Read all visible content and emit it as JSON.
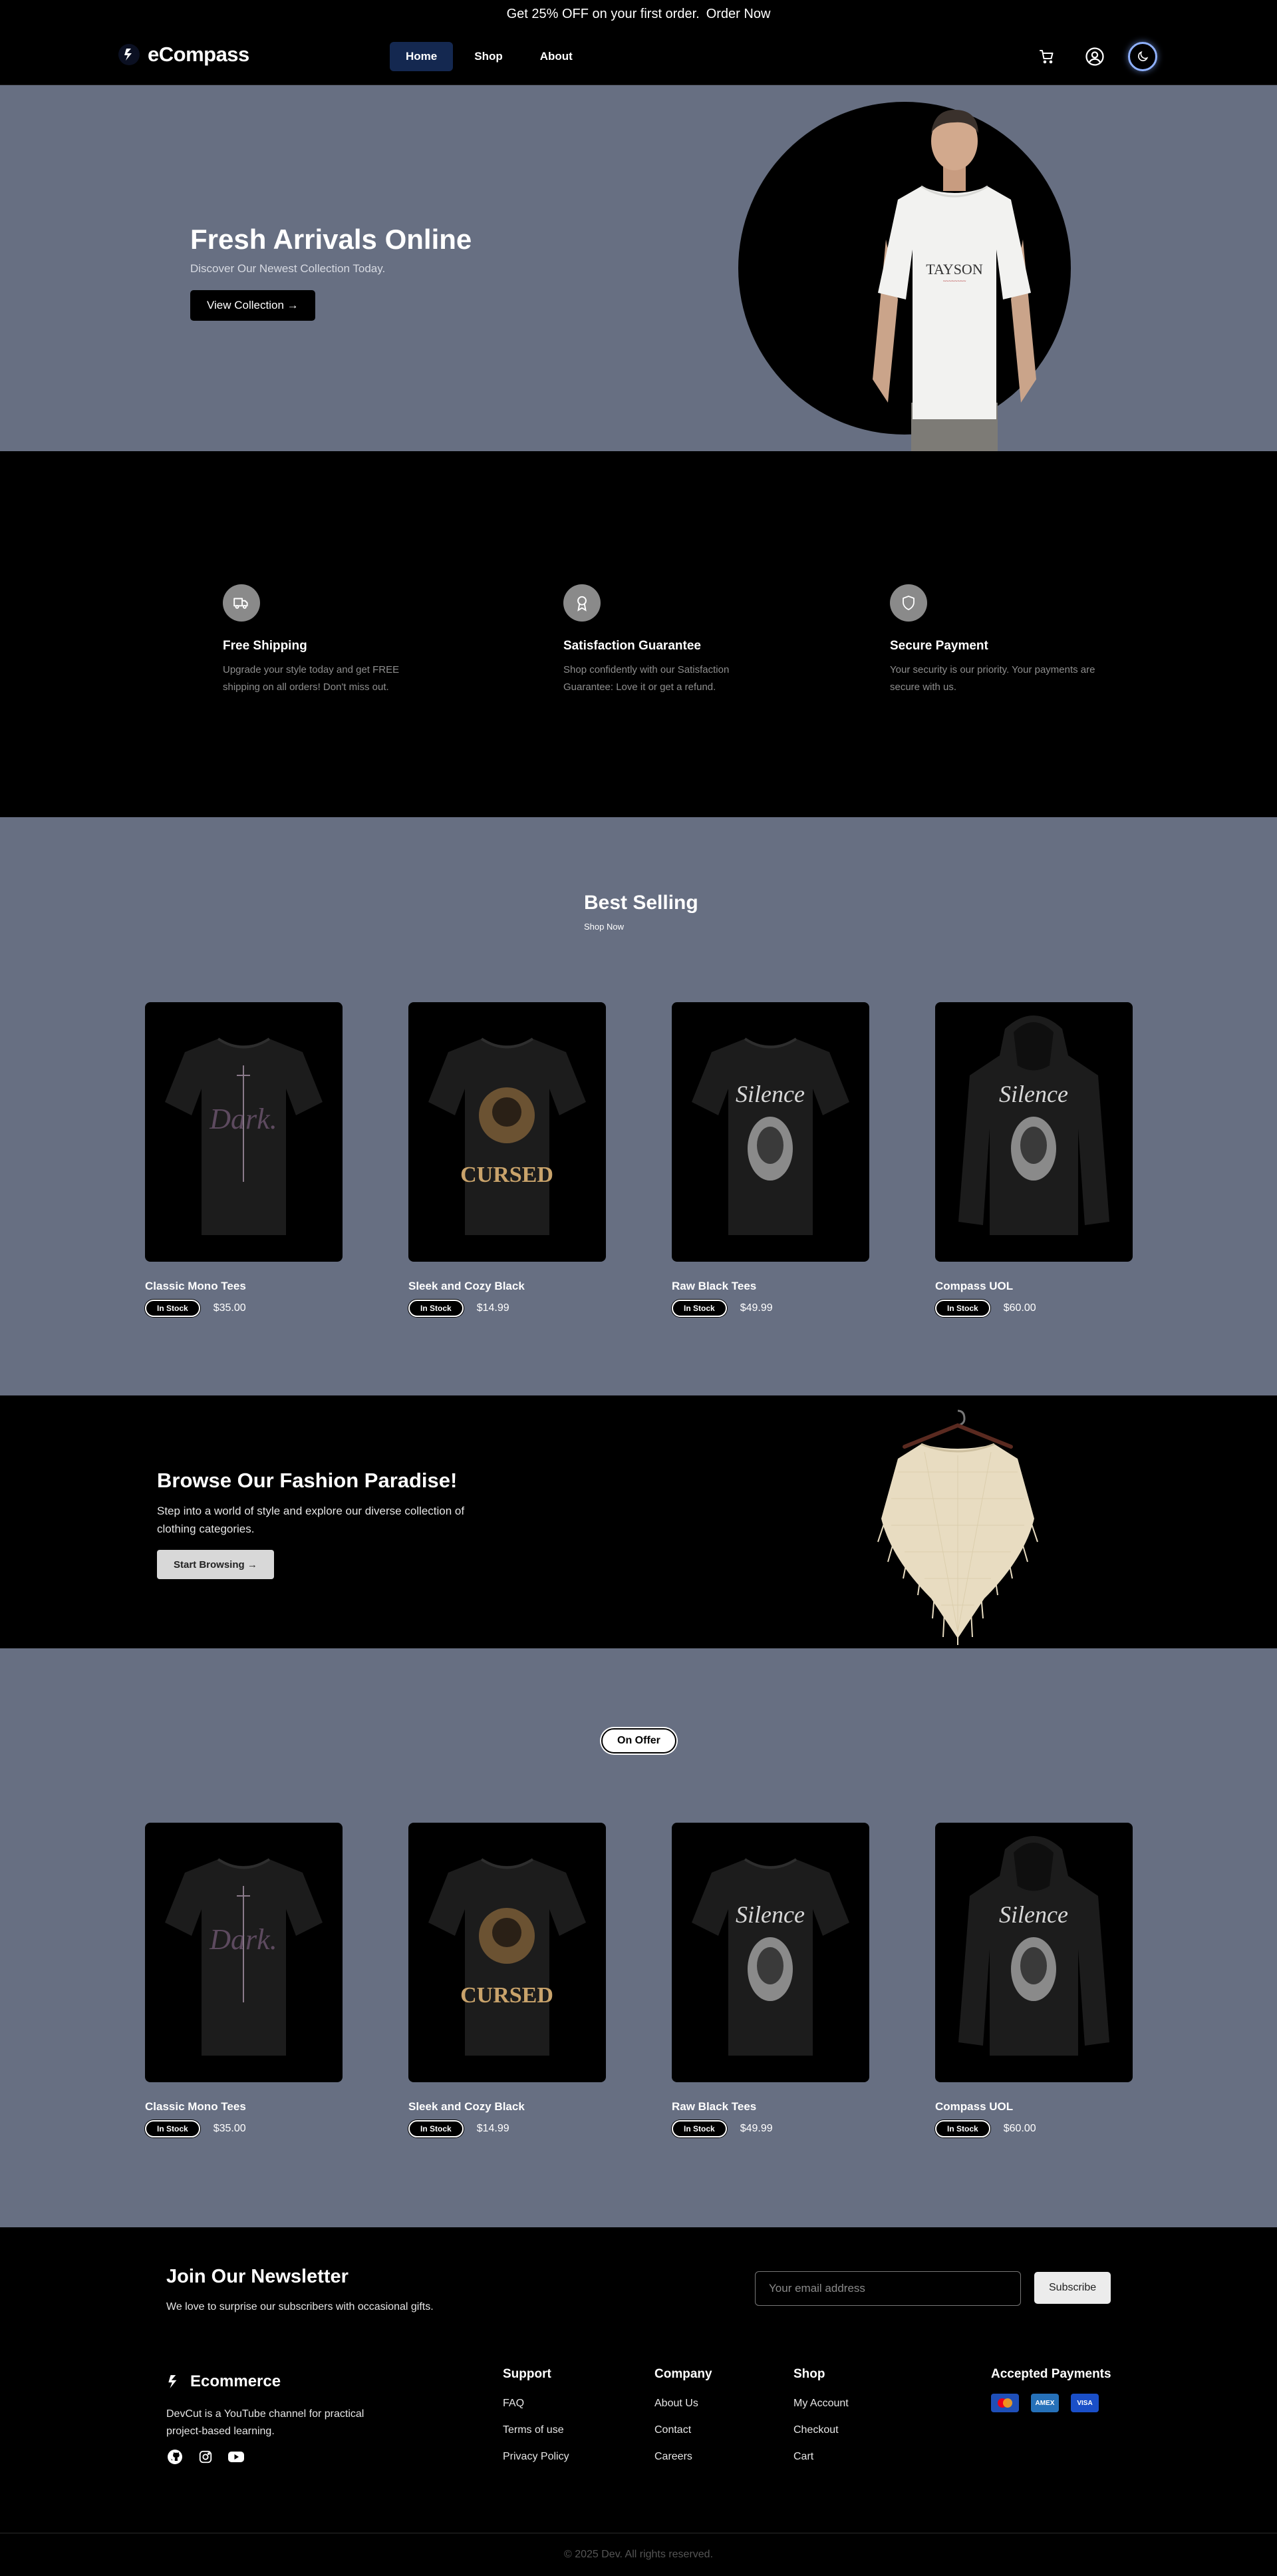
{
  "announcement": {
    "text": "Get 25% OFF on your first order.",
    "link": "Order Now"
  },
  "header": {
    "brand": "eCompass",
    "nav": [
      "Home",
      "Shop",
      "About"
    ]
  },
  "hero": {
    "title": "Fresh Arrivals Online",
    "subtitle": "Discover Our Newest Collection Today.",
    "button": "View Collection →",
    "shirt_text": "TAYSON"
  },
  "features": [
    {
      "title": "Free Shipping",
      "desc": "Upgrade your style today and get FREE shipping on all orders! Don't miss out.",
      "icon": "truck-icon"
    },
    {
      "title": "Satisfaction Guarantee",
      "desc": "Shop confidently with our Satisfaction Guarantee: Love it or get a refund.",
      "icon": "award-icon"
    },
    {
      "title": "Secure Payment",
      "desc": "Your security is our priority. Your payments are secure with us.",
      "icon": "shield-icon"
    }
  ],
  "best_selling": {
    "title": "Best Selling",
    "subtitle": "Shop Now",
    "products": [
      {
        "name": "Classic Mono Tees",
        "stock": "In Stock",
        "price": "$35.00",
        "art": "Dark."
      },
      {
        "name": "Sleek and Cozy Black",
        "stock": "In Stock",
        "price": "$14.99",
        "art": "CURSED"
      },
      {
        "name": "Raw Black Tees",
        "stock": "In Stock",
        "price": "$49.99",
        "art": "Silence"
      },
      {
        "name": "Compass UOL",
        "stock": "In Stock",
        "price": "$60.00",
        "art": "Silence"
      }
    ]
  },
  "banner": {
    "title": "Browse Our Fashion Paradise!",
    "desc": "Step into a world of style and explore our diverse collection of clothing categories.",
    "button": "Start Browsing →"
  },
  "on_offer": {
    "label": "On Offer",
    "products": [
      {
        "name": "Classic Mono Tees",
        "stock": "In Stock",
        "price": "$35.00",
        "art": "Dark."
      },
      {
        "name": "Sleek and Cozy Black",
        "stock": "In Stock",
        "price": "$14.99",
        "art": "CURSED"
      },
      {
        "name": "Raw Black Tees",
        "stock": "In Stock",
        "price": "$49.99",
        "art": "Silence"
      },
      {
        "name": "Compass UOL",
        "stock": "In Stock",
        "price": "$60.00",
        "art": "Silence"
      }
    ]
  },
  "newsletter": {
    "title": "Join Our Newsletter",
    "desc": "We love to surprise our subscribers with occasional gifts.",
    "placeholder": "Your email address",
    "button": "Subscribe"
  },
  "footer": {
    "brand": "Ecommerce",
    "desc": "DevCut is a YouTube channel for practical project-based learning.",
    "columns": [
      {
        "title": "Support",
        "links": [
          "FAQ",
          "Terms of use",
          "Privacy Policy"
        ]
      },
      {
        "title": "Company",
        "links": [
          "About Us",
          "Contact",
          "Careers"
        ]
      },
      {
        "title": "Shop",
        "links": [
          "My Account",
          "Checkout",
          "Cart"
        ]
      }
    ],
    "payments_title": "Accepted Payments",
    "payments": [
      "mastercard",
      "AMEX",
      "VISA"
    ],
    "copyright": "© 2025 Dev. All rights reserved."
  },
  "colors": {
    "section_bg": "#676f82",
    "dark": "#000000",
    "nav_active": "#142850"
  }
}
